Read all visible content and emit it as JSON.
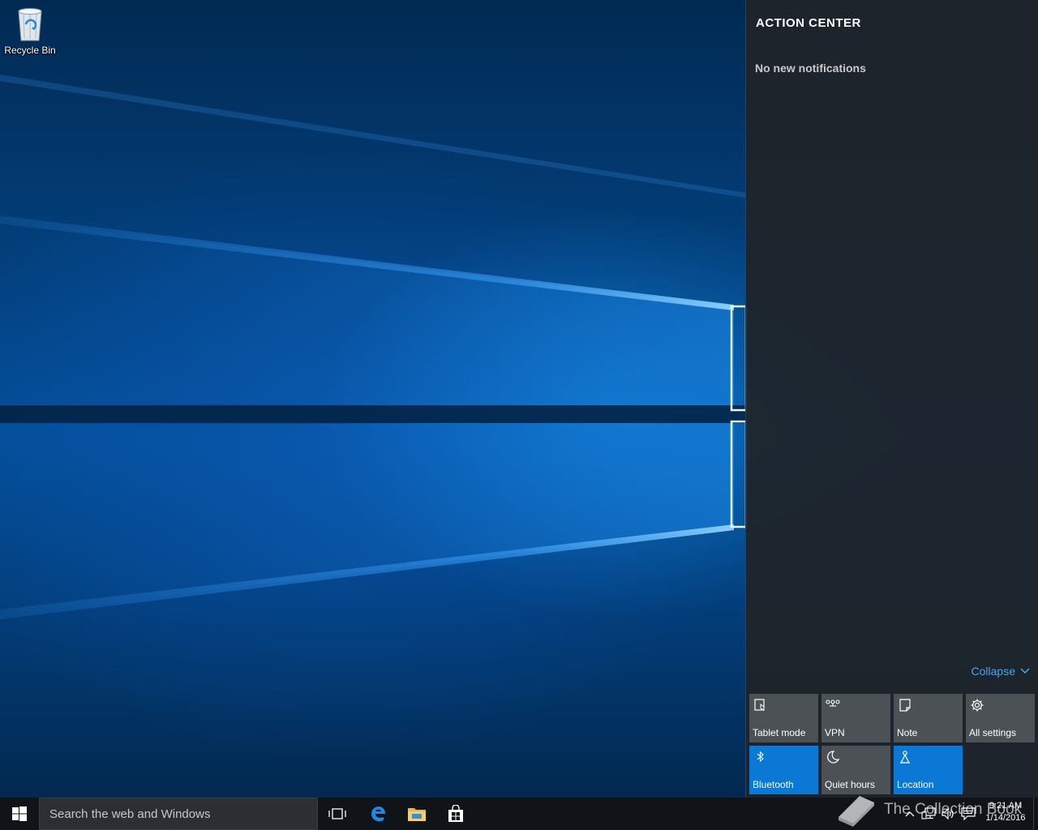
{
  "desktop": {
    "icons": [
      {
        "label": "Recycle Bin",
        "icon": "recycle-bin-icon"
      }
    ]
  },
  "action_center": {
    "title": "ACTION CENTER",
    "empty_message": "No new notifications",
    "collapse_label": "Collapse",
    "quick_actions": [
      {
        "label": "Tablet mode",
        "icon": "tablet-mode-icon",
        "active": false
      },
      {
        "label": "VPN",
        "icon": "vpn-icon",
        "active": false
      },
      {
        "label": "Note",
        "icon": "note-icon",
        "active": false
      },
      {
        "label": "All settings",
        "icon": "gear-icon",
        "active": false
      },
      {
        "label": "Bluetooth",
        "icon": "bluetooth-icon",
        "active": true
      },
      {
        "label": "Quiet hours",
        "icon": "moon-icon",
        "active": false
      },
      {
        "label": "Location",
        "icon": "location-icon",
        "active": true
      }
    ],
    "colors": {
      "tile": "#4c5156",
      "tile_active": "#0a78d4",
      "link": "#4ea3f0"
    }
  },
  "taskbar": {
    "search_placeholder": "Search the web and Windows",
    "pinned": [
      {
        "name": "task-view",
        "icon": "task-view-icon"
      },
      {
        "name": "edge",
        "icon": "edge-icon"
      },
      {
        "name": "file-explorer",
        "icon": "folder-icon"
      },
      {
        "name": "store",
        "icon": "store-icon"
      }
    ],
    "tray_icons": [
      "chevron-up-icon",
      "network-icon",
      "volume-icon",
      "action-center-icon"
    ],
    "clock": {
      "time": "9:21 AM",
      "date": "1/14/2016"
    }
  },
  "watermark": {
    "text": "The Collection Book"
  }
}
